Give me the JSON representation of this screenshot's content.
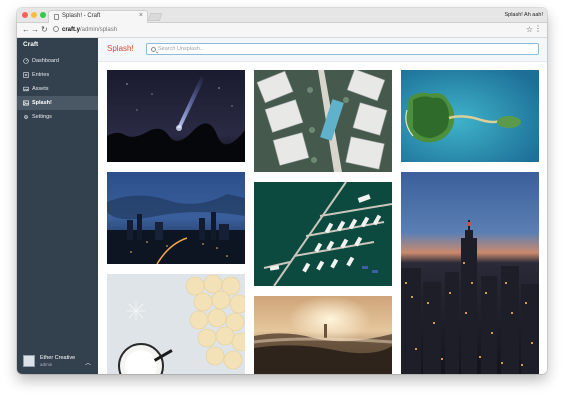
{
  "browser": {
    "tab_title": "Splash! - Craft",
    "tab_close": "×",
    "profile_name": "Splash! Ah aah!",
    "url_host": "craft.y",
    "url_path": "/admin/splash",
    "back_icon": "←",
    "forward_icon": "→",
    "reload_icon": "↻",
    "star_icon": "☆",
    "menu_icon": "⋮"
  },
  "sidebar": {
    "brand": "Craft",
    "items": [
      {
        "label": "Dashboard",
        "icon": "gauge-icon",
        "active": false
      },
      {
        "label": "Entries",
        "icon": "entries-icon",
        "active": false
      },
      {
        "label": "Assets",
        "icon": "assets-icon",
        "active": false
      },
      {
        "label": "Splash!",
        "icon": "image-icon",
        "active": true
      },
      {
        "label": "Settings",
        "icon": "gear-icon",
        "active": false
      }
    ],
    "user": {
      "name": "Ether Creative",
      "role": "admin",
      "chevron": "︿"
    }
  },
  "header": {
    "title": "Splash!",
    "search_placeholder": "Search Unsplash..."
  },
  "photos": [
    {
      "subject": "starry night sky with light beam"
    },
    {
      "subject": "aerial view of apartment towers and pool"
    },
    {
      "subject": "aerial view of tropical island"
    },
    {
      "subject": "city skyline at dusk under cloudy blue sky"
    },
    {
      "subject": "aerial view of marina with boats"
    },
    {
      "subject": "city at night from above, Empire State Building"
    },
    {
      "subject": "cookies and cup of milk on white table"
    },
    {
      "subject": "foggy sunrise over town"
    }
  ],
  "colors": {
    "sidebar_bg": "#33404d",
    "sidebar_active": "#4a5866",
    "title_accent": "#d74a36",
    "search_border": "#8fbcdc"
  }
}
